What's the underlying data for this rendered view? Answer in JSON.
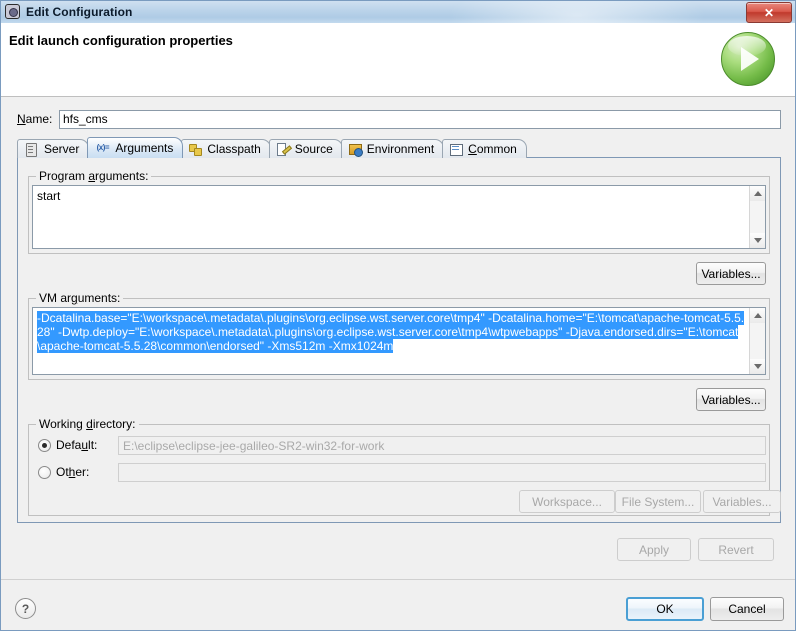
{
  "window": {
    "title": "Edit Configuration",
    "title_icon": "gear-icon",
    "close_label": "✕"
  },
  "header": {
    "title": "Edit launch configuration properties",
    "run_icon": "green-play-icon"
  },
  "name_field": {
    "label": "Name:",
    "label_mnemonic": "N",
    "value": "hfs_cms"
  },
  "tabs": [
    {
      "label": "Server",
      "icon": "server-icon",
      "active": false
    },
    {
      "label": "Arguments",
      "icon": "arguments-icon",
      "active": true
    },
    {
      "label": "Classpath",
      "icon": "classpath-icon",
      "active": false
    },
    {
      "label": "Source",
      "icon": "source-icon",
      "active": false
    },
    {
      "label": "Environment",
      "icon": "environment-icon",
      "active": false
    },
    {
      "label": "Common",
      "icon": "common-icon",
      "active": false
    }
  ],
  "program_arguments": {
    "group_label": "Program arguments:",
    "value": "start",
    "variables_button": "Variables..."
  },
  "vm_arguments": {
    "group_label": "VM arguments:",
    "value": "-Dcatalina.base=\"E:\\workspace\\.metadata\\.plugins\\org.eclipse.wst.server.core\\tmp4\" -Dcatalina.home=\"E:\\tomcat\\apache-tomcat-5.5.28\" -Dwtp.deploy=\"E:\\workspace\\.metadata\\.plugins\\org.eclipse.wst.server.core\\tmp4\\wtpwebapps\" -Djava.endorsed.dirs=\"E:\\tomcat\\apache-tomcat-5.5.28\\common\\endorsed\" -Xms512m -Xmx1024m",
    "selected": true,
    "variables_button": "Variables..."
  },
  "working_directory": {
    "group_label": "Working directory:",
    "default_radio_label": "Default:",
    "default_selected": true,
    "default_value": "E:\\eclipse\\eclipse-jee-galileo-SR2-win32-for-work",
    "other_radio_label": "Other:",
    "other_selected": false,
    "other_value": "",
    "buttons": [
      {
        "label": "Workspace...",
        "enabled": false
      },
      {
        "label": "File System...",
        "enabled": false
      },
      {
        "label": "Variables...",
        "enabled": false
      }
    ]
  },
  "action_buttons": {
    "apply": {
      "label": "Apply",
      "enabled": false
    },
    "revert": {
      "label": "Revert",
      "enabled": false
    }
  },
  "footer": {
    "help_icon": "?",
    "ok": {
      "label": "OK",
      "default": true
    },
    "cancel": {
      "label": "Cancel",
      "default": false
    }
  },
  "colors": {
    "selection_blue": "#3399ff",
    "title_bar": "#bcd4ea",
    "accent_green": "#74bb48",
    "close_red": "#c0392c"
  }
}
